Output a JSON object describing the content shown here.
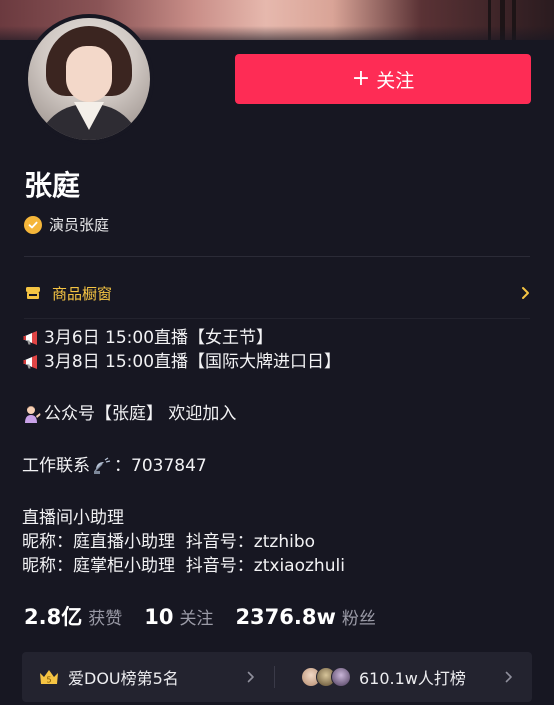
{
  "profile": {
    "name": "张庭",
    "verified_label": "演员张庭",
    "follow_label": "关注",
    "follow_plus": "+"
  },
  "shop": {
    "label": "商品橱窗"
  },
  "bio": {
    "line1": "3月6日 15:00直播【女王节】",
    "line2": "3月8日 15:00直播【国际大牌进口日】",
    "line3": "公众号【张庭】 欢迎加入",
    "line4_prefix": "工作联系",
    "line4_suffix": "：7037847",
    "line5": "直播间小助理",
    "line6": "昵称：庭直播小助理  抖音号：ztzhibo",
    "line7": "昵称：庭掌柜小助理  抖音号：ztxiaozhuli"
  },
  "stats": {
    "likes_value": "2.8亿",
    "likes_label": "获赞",
    "following_value": "10",
    "following_label": "关注",
    "followers_value": "2376.8w",
    "followers_label": "粉丝"
  },
  "rank": {
    "badge_text": "5",
    "title": "爱DOU榜第5名",
    "count": "610.1w人打榜"
  },
  "icons": {
    "megaphone": "megaphone-icon",
    "person": "person-tipping-hand-icon",
    "satellite": "satellite-icon",
    "verify": "verified-check-icon",
    "shop": "shop-icon"
  },
  "colors": {
    "accent": "#fe2c55",
    "gold": "#f5c443",
    "background": "#171722"
  }
}
